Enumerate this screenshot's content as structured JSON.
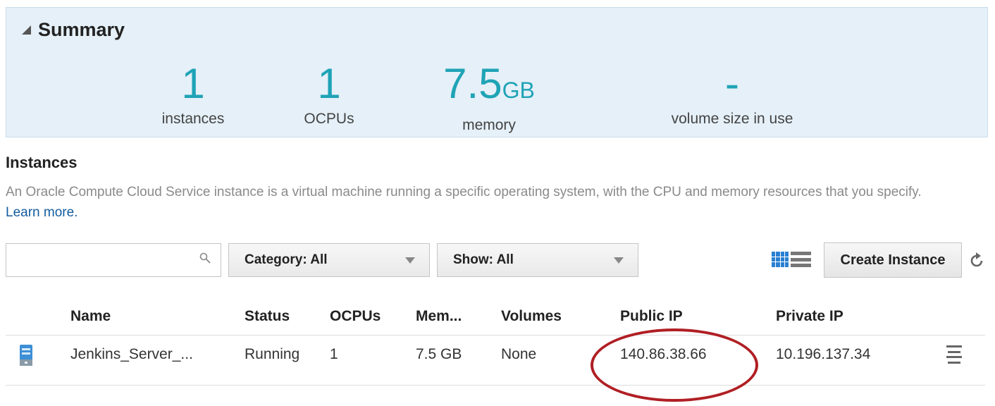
{
  "summary": {
    "title": "Summary",
    "metrics": [
      {
        "value": "1",
        "unit": "",
        "label": "instances"
      },
      {
        "value": "1",
        "unit": "",
        "label": "OCPUs"
      },
      {
        "value": "7.5",
        "unit": "GB",
        "label": "memory"
      },
      {
        "value": "-",
        "unit": "",
        "label": "volume size in use"
      }
    ]
  },
  "instances": {
    "title": "Instances",
    "description": "An Oracle Compute Cloud Service instance is a virtual machine running a specific operating system, with the CPU and memory resources that you specify.",
    "learn_more": "Learn more."
  },
  "toolbar": {
    "search_value": "",
    "search_icon": "search-icon",
    "category_label": "Category: All",
    "show_label": "Show: All",
    "create_label": "Create Instance"
  },
  "table": {
    "columns": [
      "Name",
      "Status",
      "OCPUs",
      "Mem...",
      "Volumes",
      "Public IP",
      "Private IP"
    ],
    "rows": [
      {
        "name": "Jenkins_Server_...",
        "status": "Running",
        "ocpus": "1",
        "memory": "7.5 GB",
        "volumes": "None",
        "public_ip": "140.86.38.66",
        "private_ip": "10.196.137.34"
      }
    ]
  },
  "colors": {
    "accent": "#1fa3b6",
    "panel_bg": "#e5f0f8",
    "link": "#145c9e",
    "highlight": "#b01f24"
  }
}
